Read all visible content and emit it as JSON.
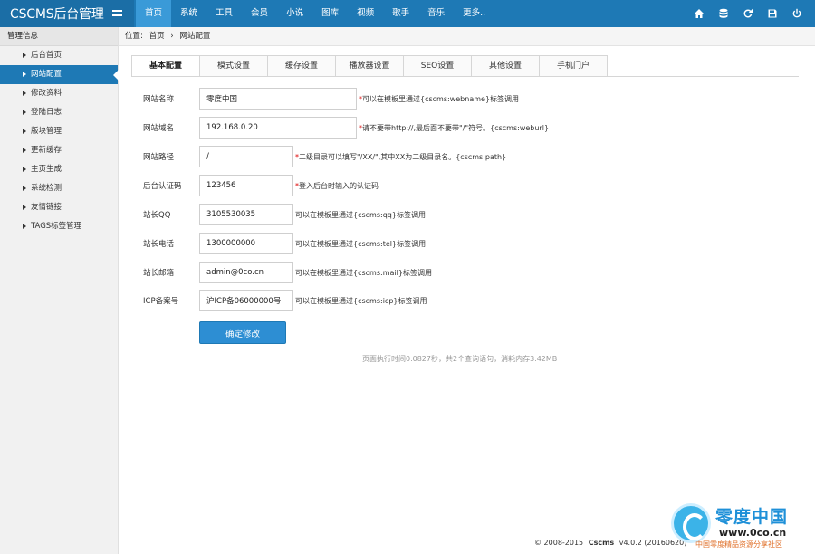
{
  "header": {
    "title": "CSCMS后台管理",
    "nav": [
      "首页",
      "系统",
      "工具",
      "会员",
      "小说",
      "图库",
      "视频",
      "歌手",
      "音乐",
      "更多.."
    ],
    "active_nav_index": 0,
    "icons": [
      "home-icon",
      "database-icon",
      "refresh-icon",
      "save-icon",
      "power-icon"
    ]
  },
  "sidebar": {
    "title": "管理信息",
    "items": [
      {
        "label": "后台首页"
      },
      {
        "label": "网站配置"
      },
      {
        "label": "修改资料"
      },
      {
        "label": "登陆日志"
      },
      {
        "label": "版块管理"
      },
      {
        "label": "更新缓存"
      },
      {
        "label": "主页生成"
      },
      {
        "label": "系统检测"
      },
      {
        "label": "友情链接"
      },
      {
        "label": "TAGS标签管理"
      }
    ],
    "active_index": 1
  },
  "breadcrumb": {
    "prefix": "位置:",
    "home": "首页",
    "sep": "›",
    "current": "网站配置"
  },
  "tabs": [
    "基本配置",
    "模式设置",
    "缓存设置",
    "播放器设置",
    "SEO设置",
    "其他设置",
    "手机门户"
  ],
  "active_tab_index": 0,
  "form": {
    "rows": [
      {
        "label": "网站名称",
        "value": "零度中国",
        "star": true,
        "hint": "可以在模板里通过{cscms:webname}标签调用"
      },
      {
        "label": "网站域名",
        "value": "192.168.0.20",
        "star": true,
        "hint": "请不要带http://,最后面不要带\"/\"符号。{cscms:weburl}"
      },
      {
        "label": "网站路径",
        "value": "/",
        "star": true,
        "hint": "二级目录可以填写\"/XX/\",其中XX为二级目录名。{cscms:path}"
      },
      {
        "label": "后台认证码",
        "value": "123456",
        "star": true,
        "hint": "登入后台时输入的认证码"
      },
      {
        "label": "站长QQ",
        "value": "3105530035",
        "star": false,
        "hint": "可以在模板里通过{cscms:qq}标签调用"
      },
      {
        "label": "站长电话",
        "value": "1300000000",
        "star": false,
        "hint": "可以在模板里通过{cscms:tel}标签调用"
      },
      {
        "label": "站长邮箱",
        "value": "admin@0co.cn",
        "star": false,
        "hint": "可以在模板里通过{cscms:mail}标签调用"
      },
      {
        "label": "ICP备案号",
        "value": "沪ICP备06000000号",
        "star": false,
        "hint": "可以在模板里通过{cscms:icp}标签调用"
      }
    ],
    "submit_label": "确定修改"
  },
  "perf_text": "页面执行时间0.0827秒，共2个查询语句，消耗内存3.42MB",
  "footer": {
    "copyright": "© 2008-2015",
    "brand": "Cscms",
    "version": "v4.0.2 (20160620)"
  },
  "watermark": {
    "title": "零度中国",
    "url": "www.0co.cn",
    "sub": "中国零度精品资源分享社区"
  }
}
